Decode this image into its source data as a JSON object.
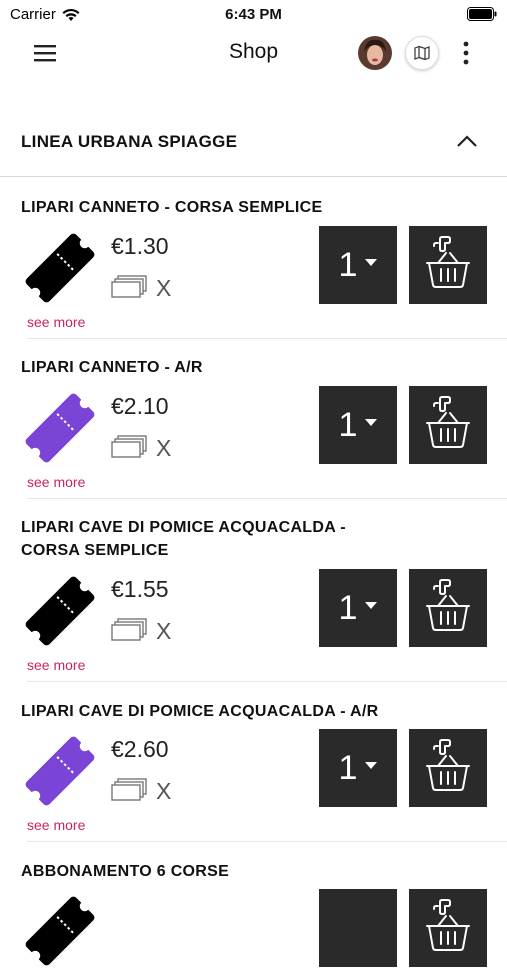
{
  "status_bar": {
    "carrier": "Carrier",
    "time": "6:43 PM"
  },
  "nav": {
    "title": "Shop"
  },
  "section": {
    "title": "LINEA URBANA SPIAGGE"
  },
  "products": [
    {
      "name_line1": "LIPARI CANNETO - CORSA SEMPLICE",
      "name_line2": "",
      "price": "€1.30",
      "multiplier": "X",
      "quantity": "1",
      "see_more": "see more",
      "ticket_color": "#000000"
    },
    {
      "name_line1": "LIPARI CANNETO - A/R",
      "name_line2": "",
      "price": "€2.10",
      "multiplier": "X",
      "quantity": "1",
      "see_more": "see more",
      "ticket_color": "#7a44d6"
    },
    {
      "name_line1": "LIPARI CAVE  DI POMICE ACQUACALDA -",
      "name_line2": "CORSA SEMPLICE",
      "price": "€1.55",
      "multiplier": "X",
      "quantity": "1",
      "see_more": "see more",
      "ticket_color": "#000000"
    },
    {
      "name_line1": "LIPARI CAVE  DI POMICE ACQUACALDA - A/R",
      "name_line2": "",
      "price": "€2.60",
      "multiplier": "X",
      "quantity": "1",
      "see_more": "see more",
      "ticket_color": "#7a44d6"
    },
    {
      "name_line1": "ABBONAMENTO 6 CORSE",
      "name_line2": "",
      "price": "",
      "multiplier": "",
      "quantity": "",
      "see_more": "",
      "ticket_color": "#000000"
    }
  ],
  "colors": {
    "accent": "#c8285a",
    "button_bg": "#2a2a2a",
    "purple_ticket": "#7a44d6"
  }
}
